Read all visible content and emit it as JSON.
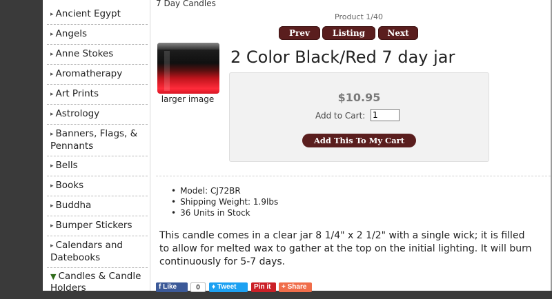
{
  "breadcrumb": "7 Day Candles",
  "sidebar": {
    "items": [
      {
        "label": "Ancient Egypt"
      },
      {
        "label": "Angels"
      },
      {
        "label": "Anne Stokes"
      },
      {
        "label": "Aromatherapy"
      },
      {
        "label": "Art Prints"
      },
      {
        "label": "Astrology"
      },
      {
        "label": "Banners, Flags, &",
        "label2": "Pennants"
      },
      {
        "label": "Bells"
      },
      {
        "label": "Books"
      },
      {
        "label": "Buddha"
      },
      {
        "label": "Bumper Stickers"
      },
      {
        "label": "Calendars and",
        "label2": "Datebooks"
      },
      {
        "label": "Candles & Candle",
        "label2": "Holders"
      }
    ]
  },
  "product": {
    "counter": "Product 1/40",
    "nav": {
      "prev": "Prev",
      "listing": "Listing",
      "next": "Next"
    },
    "title": "2 Color Black/Red 7 day jar",
    "larger_image": "larger image",
    "price": "$10.95",
    "add_to_cart_label": "Add to Cart:",
    "quantity": "1",
    "add_button": "Add This To My Cart",
    "specs": [
      "Model: CJ72BR",
      "Shipping Weight: 1.9lbs",
      "36 Units in Stock"
    ],
    "description": "This candle comes in a clear jar 8 1/4\" x 2 1/2\" with a single wick; it is filled to allow for melted wax to gather at the top on the initial lighting. It will burn continuously for 5-7 days."
  },
  "social": {
    "like": "Like",
    "like_count": "0",
    "tweet": "Tweet",
    "pin": "Pin it",
    "share": "Share"
  },
  "colors": {
    "button": "#5a1e1e",
    "price": "#7a7a7a"
  }
}
